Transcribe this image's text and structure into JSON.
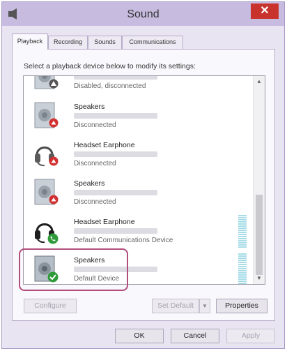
{
  "window": {
    "title": "Sound",
    "close_label": "✕"
  },
  "tabs": [
    {
      "label": "Playback",
      "active": true
    },
    {
      "label": "Recording",
      "active": false
    },
    {
      "label": "Sounds",
      "active": false
    },
    {
      "label": "Communications",
      "active": false
    }
  ],
  "instruction": "Select a playback device below to modify its settings:",
  "devices": [
    {
      "name": "",
      "status": "Disabled, disconnected",
      "type": "speaker",
      "badge": "disabled"
    },
    {
      "name": "Speakers",
      "status": "Disconnected",
      "type": "speaker",
      "badge": "disconnected"
    },
    {
      "name": "Headset Earphone",
      "status": "Disconnected",
      "type": "headset",
      "badge": "disconnected"
    },
    {
      "name": "Speakers",
      "status": "Disconnected",
      "type": "speaker",
      "badge": "disconnected"
    },
    {
      "name": "Headset Earphone",
      "status": "Default Communications Device",
      "type": "headset",
      "badge": "comm"
    },
    {
      "name": "Speakers",
      "status": "Default Device",
      "type": "speaker",
      "badge": "default"
    }
  ],
  "buttons": {
    "configure": "Configure",
    "set_default": "Set Default",
    "properties": "Properties",
    "ok": "OK",
    "cancel": "Cancel",
    "apply": "Apply"
  },
  "icons": {
    "app": "speaker-icon",
    "close": "close-icon",
    "scroll_up": "▲",
    "scroll_down": "▼",
    "dropdown": "▼"
  },
  "colors": {
    "titlebar": "#c7bce0",
    "close": "#c9332e",
    "badge_down": "#d23030",
    "badge_comm": "#2f9a3a",
    "badge_default": "#2f9a3a",
    "highlight": "#b04d7c",
    "level_meter": "#a8dde8"
  }
}
